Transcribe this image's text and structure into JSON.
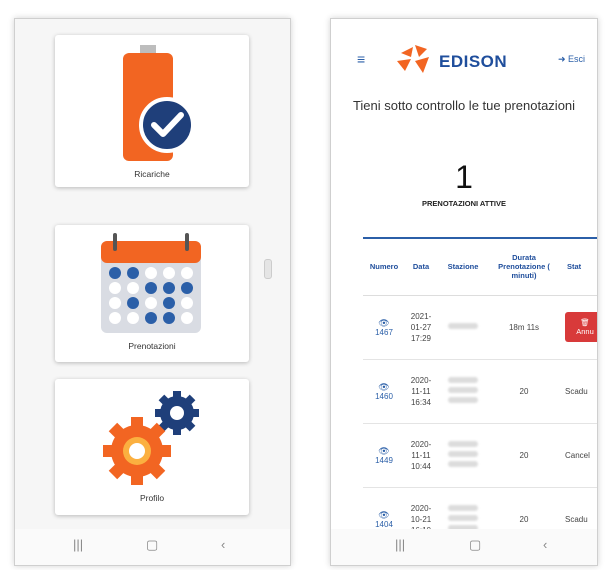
{
  "left": {
    "tiles": [
      {
        "label": "Ricariche"
      },
      {
        "label": "Prenotazioni"
      },
      {
        "label": "Profilo"
      }
    ]
  },
  "right": {
    "logo_text": "EDISON",
    "logout_label": "Esci",
    "headline": "Tieni sotto controllo le tue prenotazioni",
    "active_count": "1",
    "active_label": "PRENOTAZIONI ATTIVE",
    "columns": [
      "Numero",
      "Data",
      "Stazione",
      "Durata Prenotazione ( minuti)",
      "Stat"
    ],
    "rows": [
      {
        "numero": "1467",
        "date": "2021-",
        "date2": "01-27",
        "time": "17:29",
        "durata": "18m 11s",
        "stato": "Annu"
      },
      {
        "numero": "1460",
        "date": "2020-",
        "date2": "11-11",
        "time": "16:34",
        "durata": "20",
        "stato": "Scadu"
      },
      {
        "numero": "1449",
        "date": "2020-",
        "date2": "11-11",
        "time": "10:44",
        "durata": "20",
        "stato": "Cancel"
      },
      {
        "numero": "1404",
        "date": "2020-",
        "date2": "10-21",
        "time": "16:10",
        "durata": "20",
        "stato": "Scadu"
      }
    ]
  },
  "colors": {
    "accent": "#2b5fa8",
    "orange": "#f26522",
    "danger": "#d83a3a"
  }
}
